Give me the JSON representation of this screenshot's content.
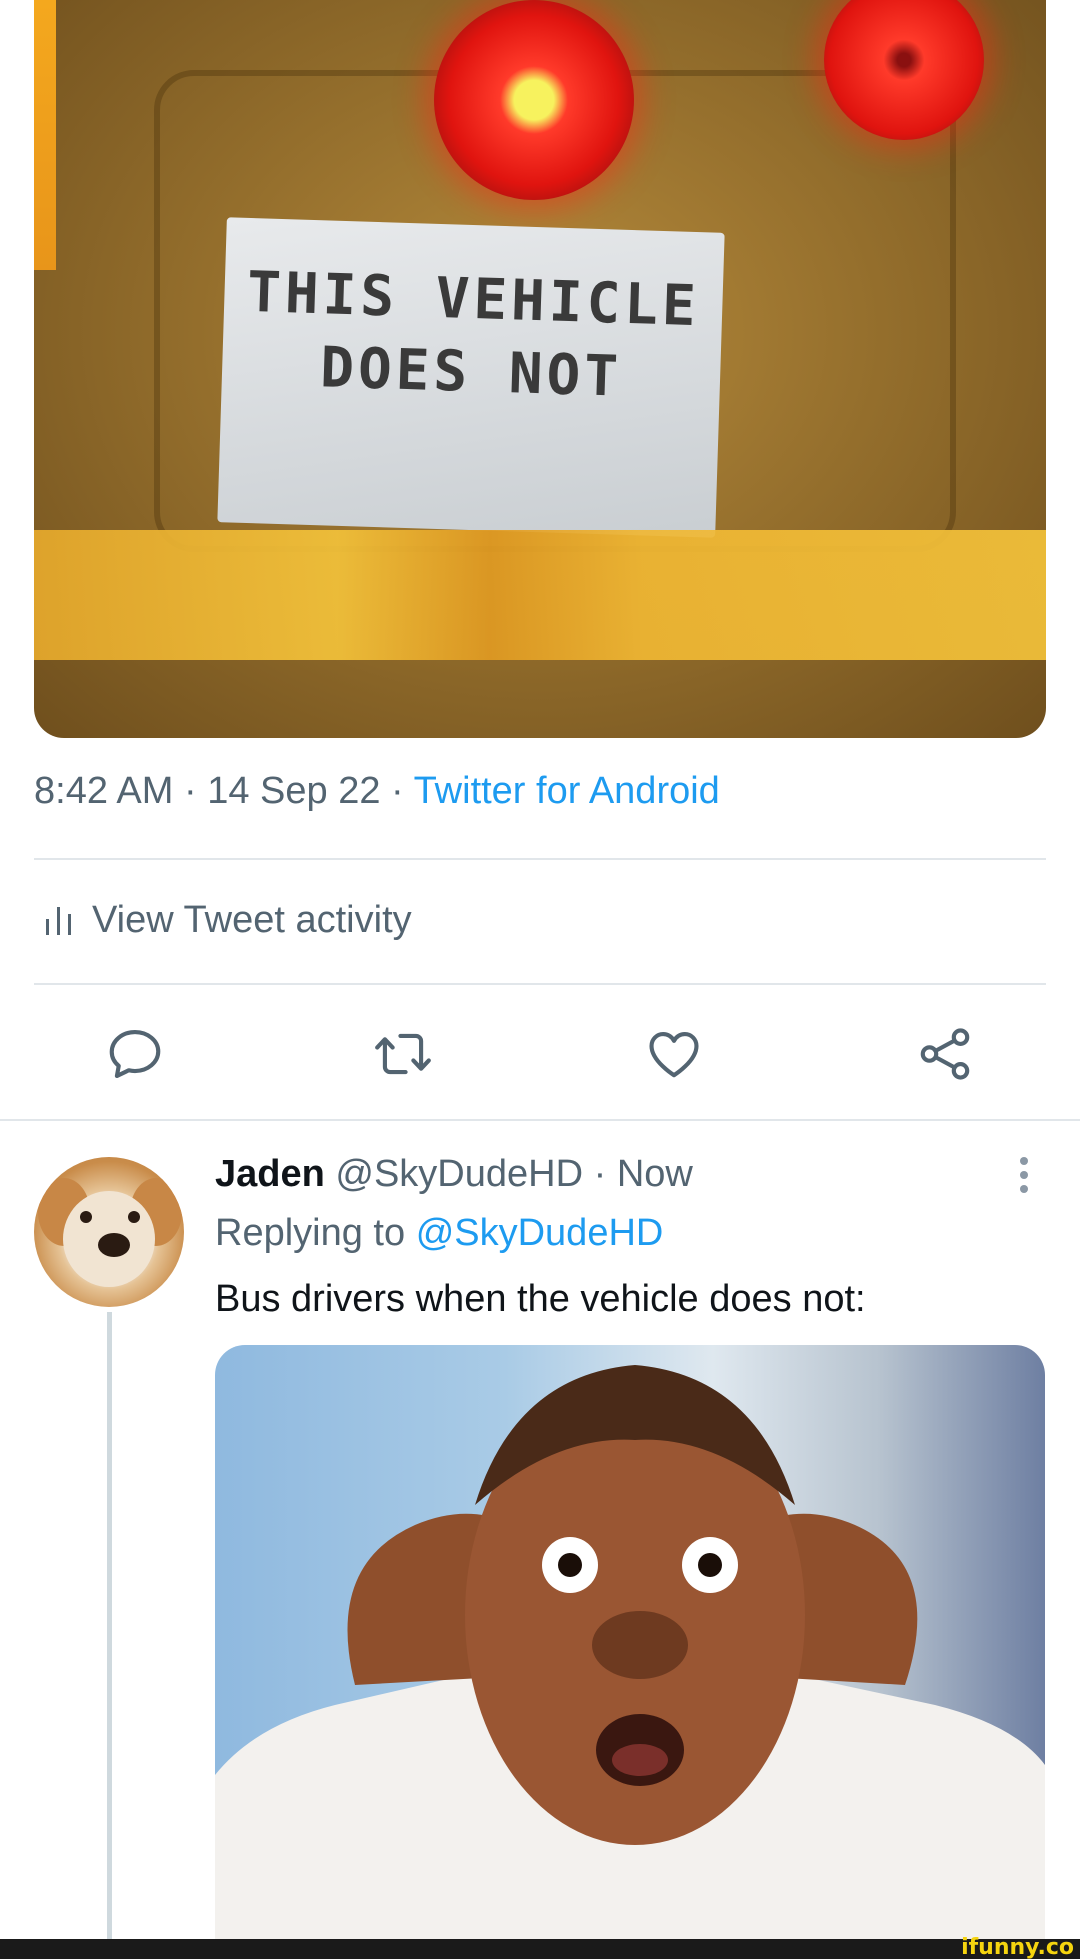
{
  "tweet": {
    "media_image": {
      "sign_text": [
        "THIS VEHICLE",
        "DOES NOT"
      ]
    },
    "time": "8:42 AM",
    "date": "14 Sep 22",
    "separator": "·",
    "source": "Twitter for Android",
    "activity_label": "View Tweet activity",
    "actions": [
      "reply-icon",
      "retweet-icon",
      "like-icon",
      "share-icon"
    ]
  },
  "reply": {
    "name": "Jaden",
    "handle": "@SkyDudeHD",
    "time": "Now",
    "replying_prefix": "Replying to",
    "replying_handle": "@SkyDudeHD",
    "text": "Bus drivers when the vehicle does not:"
  },
  "watermark": "ifunny.co",
  "colors": {
    "accent": "#1d9bf0",
    "secondary_text": "#536471",
    "primary_text": "#0f1419",
    "divider": "#e1e6ea"
  }
}
